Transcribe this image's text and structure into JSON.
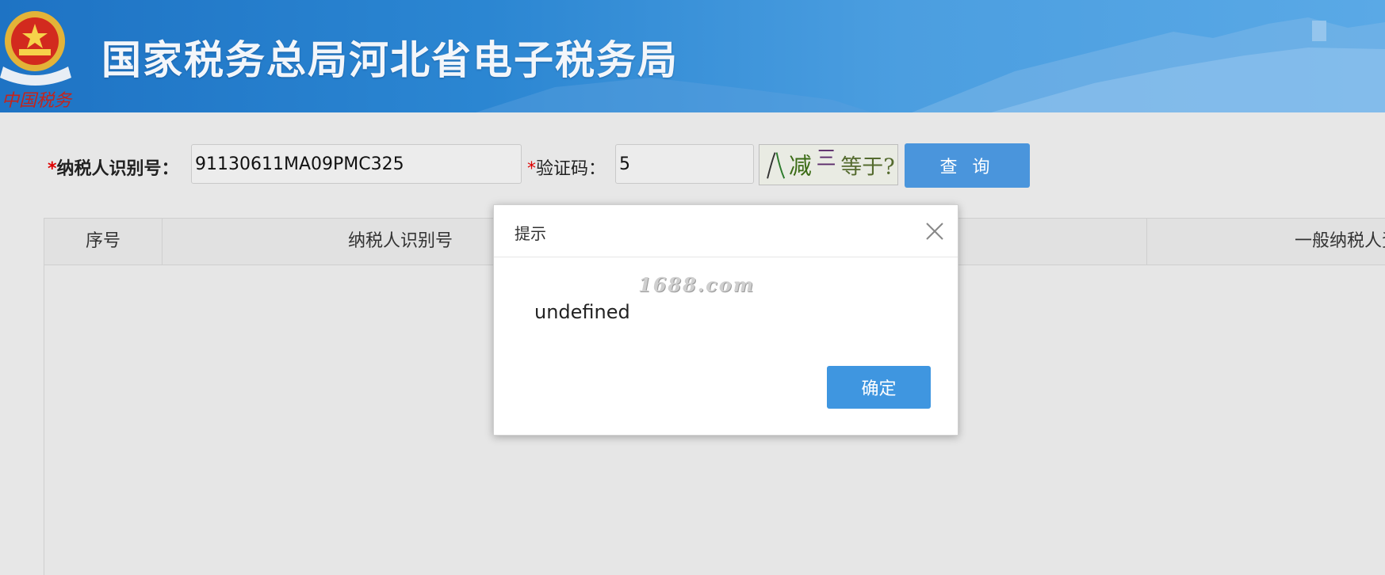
{
  "header": {
    "title": "国家税务总局河北省电子税务局",
    "emblem_caption": "中国税务"
  },
  "search_form": {
    "required_mark": "*",
    "taxpayer_id_label": "纳税人识别号：",
    "taxpayer_id_value": "91130611MA09PMC325",
    "captcha_label": "验证码：",
    "captcha_value": "5",
    "captcha_image_text": "八减三等于?",
    "query_button": "查 询"
  },
  "results_table": {
    "columns": [
      "序号",
      "纳税人识别号",
      "",
      "一般纳税人资格"
    ],
    "rows": []
  },
  "dialog": {
    "title": "提示",
    "watermark": "1688.com",
    "message": "undefined",
    "confirm_button": "确定"
  },
  "colors": {
    "banner_start": "#1e73c4",
    "banner_end": "#5aa9e6",
    "primary_button": "#4a95dc",
    "required_mark": "#dd0000"
  }
}
